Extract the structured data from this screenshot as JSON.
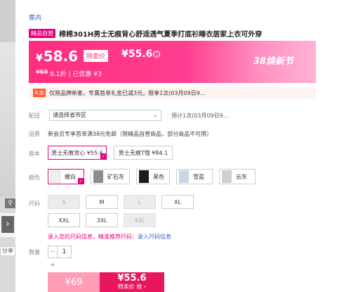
{
  "gallery": {
    "zoom_icon": "magnifier-icon",
    "arrow_label": "›",
    "share_label": "分享"
  },
  "store": {
    "name": "蕉内"
  },
  "product": {
    "brand_tag": "精品自营",
    "title": "棉棉301H男士无痕背心舒适透气夏季打底衫睡衣居家上衣可外穿"
  },
  "price": {
    "currency": "¥",
    "main": "58.6",
    "special_label": "特卖价",
    "special_price": "¥55.6",
    "info_icon": "ⓘ",
    "original": "¥69",
    "discount": "8.1折",
    "saved": "| 已优惠 ¥3",
    "festival": "38焕新节",
    "accent_color": "#ff2d7f"
  },
  "coupon": {
    "tag": "礼金",
    "text": "仅限品牌新客，专属首单礼金已减3元，限享1次(03月09日9..."
  },
  "delivery": {
    "label": "配送",
    "select_value": "请选择省市区",
    "time_text": "预计1次(03月09日9..."
  },
  "freight": {
    "label": "运费",
    "text": "新会员专享首单满38元免邮（限精品自营商品，部分商品不可用）"
  },
  "version": {
    "label": "版本",
    "options": [
      {
        "label": "男士无痕背心 ¥55.6",
        "selected": true
      },
      {
        "label": "男士无痕T恤 ¥84.1",
        "selected": false
      }
    ]
  },
  "color": {
    "label": "颜色",
    "options": [
      {
        "label": "暖白",
        "swatch": "#f2efe9",
        "selected": true
      },
      {
        "label": "矿石灰",
        "swatch": "#8a8d8f",
        "selected": false
      },
      {
        "label": "黑色",
        "swatch": "#1b1b1b",
        "selected": false
      },
      {
        "label": "雪蓝",
        "swatch": "#c9d6e3",
        "selected": false
      },
      {
        "label": "云灰",
        "swatch": "#cfcfcf",
        "selected": false
      }
    ]
  },
  "size": {
    "label": "尺码",
    "options": [
      {
        "label": "S",
        "state": "disabled"
      },
      {
        "label": "M",
        "state": "normal"
      },
      {
        "label": "L",
        "state": "disabled"
      },
      {
        "label": "XL",
        "state": "normal"
      },
      {
        "label": "XXL",
        "state": "normal"
      },
      {
        "label": "3XL",
        "state": "normal"
      },
      {
        "label": "4XL",
        "state": "disabled"
      }
    ],
    "help_prefix": "录入您的尺码信息，精准推荐尺码：",
    "help_link": "录入尺码信息"
  },
  "quantity": {
    "label": "数量",
    "value": "1",
    "minus": "−",
    "plus": "+"
  },
  "actions": {
    "buy_price": "¥69",
    "special_price": "¥55.6",
    "special_label": "特卖价 抢 ›"
  }
}
